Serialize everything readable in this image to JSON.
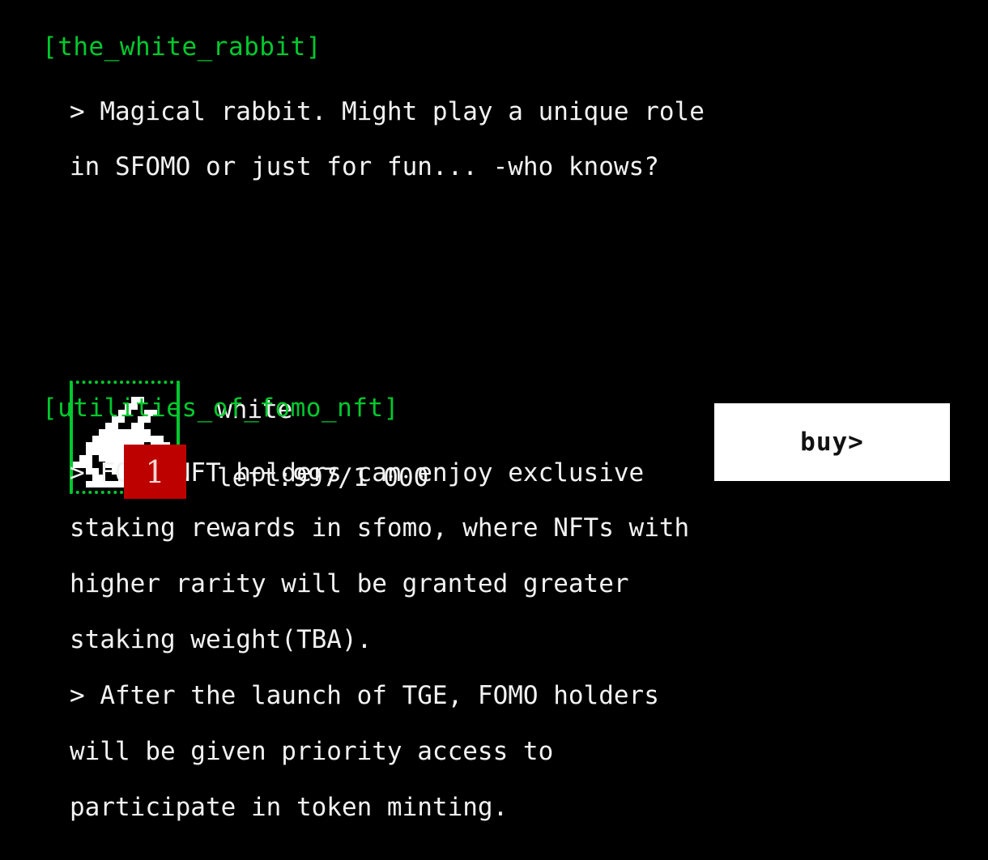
{
  "theme": {
    "background": "#000000",
    "accent_green": "#00c92e",
    "text": "#f2f2f2",
    "badge_red": "#bd0000",
    "button_bg": "#ffffff",
    "button_text": "#111111"
  },
  "sections": {
    "white_rabbit": {
      "header": "[the_white_rabbit]",
      "lines": [
        "> Magical rabbit. Might play a unique role",
        "in SFOMO or just for fun... -who knows?"
      ],
      "nft": {
        "thumbnail_icon": "white-rabbit-pixel-art-icon",
        "rarity_badge": "1",
        "name": "white",
        "supply_label": "left:997/1 000",
        "buy_label": "buy>"
      }
    },
    "utilities": {
      "header": "[utilities_of_fomo_nft]",
      "lines": [
        "> FOMO NFT holders can enjoy exclusive",
        "staking rewards in sfomo, where NFTs with",
        "higher rarity will be granted greater",
        "staking weight(TBA).",
        "> After the launch of TGE, FOMO holders",
        "will be given priority access to",
        "participate in token minting."
      ]
    }
  },
  "sprite": {
    "name": "white-rabbit-pixel-art-icon",
    "cols": 16,
    "rows": 16,
    "rowmap": [
      "0000000000000000",
      "0000000000000000",
      "0000000001100000",
      "0000000011000000",
      "0000000110011000",
      "0000001100110000",
      "0000011001100000",
      "0000111111110000",
      "0001111111111100",
      "0011111111101110",
      "0011111111111110",
      "0110111111111110",
      "1110011111111110",
      "0011001111100000",
      "0001100111110000",
      "0011111111110000"
    ]
  }
}
